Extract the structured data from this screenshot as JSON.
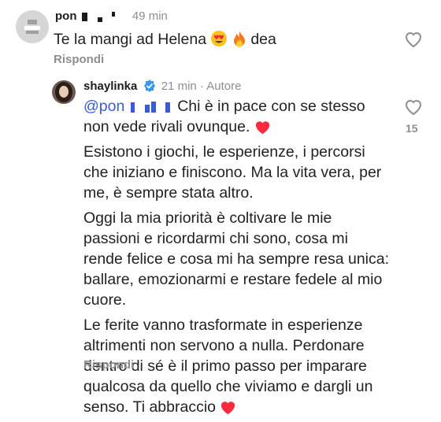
{
  "comment1": {
    "username": "pon",
    "time": "49 min",
    "text": "Te la mangi ad Helena",
    "text_after": "dea",
    "reply_label": "Rispondi"
  },
  "comment2": {
    "username": "shaylinka",
    "time": "21 min · Autore",
    "mention": "@pon",
    "intro": "Chi è in pace con se stesso non vede rivali ovunque.",
    "para2": "Esistono i giochi, le esperienze, i percorsi che iniziano e finiscono. Ma la vita vera, per me, è sempre stata altro.",
    "para3": "Oggi la mia priorità è coltivare le mie passioni e ricordarmi chi sono, cosa mi rende felice e cosa mi ha sempre resa unica: ballare, emozionarmi e restare fedele al mio cuore.",
    "para4": "Le ferite vanno trasformate in esperienze altrimenti non servono a nulla. Perdonare dentro di sé è il primo passo per imparare qualcosa da quello che viviamo e dargli un senso. Ti abbraccio",
    "reply_label": "Rispondi",
    "like_count": "15"
  },
  "colors": {
    "mention": "#3b5bd6",
    "verified": "#3897f0",
    "heart_red": "#ff2a3d",
    "muted": "#8e8e8e"
  }
}
